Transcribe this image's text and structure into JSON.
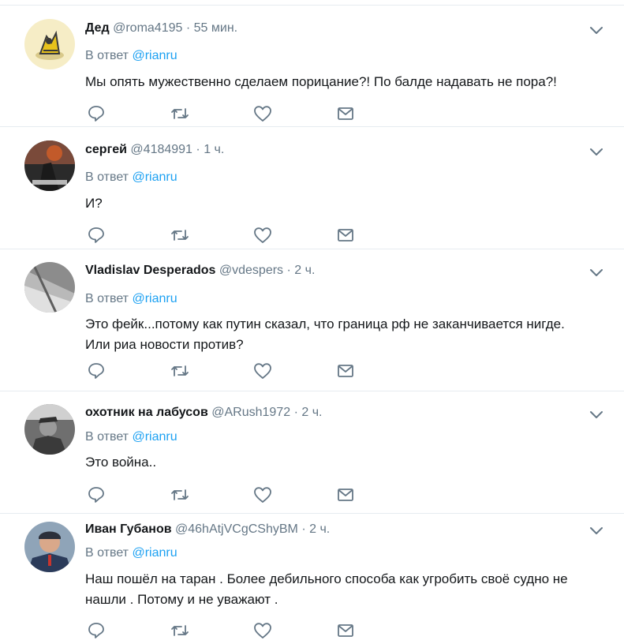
{
  "reply_prefix": "В ответ",
  "colors": {
    "link": "#1da1f2",
    "muted": "#657786",
    "text": "#14171a",
    "divider": "#e6ecf0"
  },
  "tweets": [
    {
      "name": "Дед",
      "handle": "@roma4195",
      "dot": "·",
      "time": "55 мин.",
      "reply_to": "@rianru",
      "lines": [
        "Мы опять мужественно сделаем порицание?! По балде надавать не пора?!"
      ],
      "avatar_icon": "cartoon-avatar-icon"
    },
    {
      "name": "сергей",
      "handle": "@4184991",
      "dot": "·",
      "time": "1 ч.",
      "reply_to": "@rianru",
      "lines": [
        "И?"
      ],
      "avatar_icon": "photo-avatar-icon"
    },
    {
      "name": "Vladislav Desperados",
      "handle": "@vdespers",
      "dot": "·",
      "time": "2 ч.",
      "reply_to": "@rianru",
      "lines": [
        "Это фейк...потому как путин сказал, что граница рф не заканчивается нигде.",
        "Или риа новости против?"
      ],
      "avatar_icon": "photo-avatar-icon"
    },
    {
      "name": "охотник на лабусов",
      "handle": "@ARush1972",
      "dot": "·",
      "time": "2 ч.",
      "reply_to": "@rianru",
      "lines": [
        "Это война.."
      ],
      "avatar_icon": "photo-avatar-icon"
    },
    {
      "name": "Иван Губанов",
      "handle": "@46hAtjVCgCShyBM",
      "dot": "·",
      "time": "2 ч.",
      "reply_to": "@rianru",
      "lines": [
        "Наш пошёл на таран . Более дебильного способа как угробить своё судно не",
        "нашли . Потому и не уважают ."
      ],
      "avatar_icon": "photo-avatar-icon"
    }
  ]
}
